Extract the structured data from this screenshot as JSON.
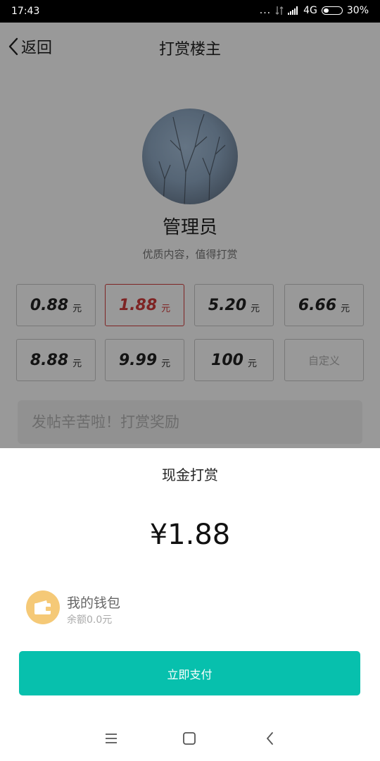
{
  "status_bar": {
    "time": "17:43",
    "dots": "...",
    "network": "4G",
    "battery": "30%",
    "icons": [
      "data-transfer-icon",
      "signal-icon",
      "battery-icon"
    ]
  },
  "navbar": {
    "back_label": "返回",
    "title": "打赏楼主"
  },
  "profile": {
    "name": "管理员",
    "subtitle": "优质内容，值得打赏"
  },
  "amounts": {
    "unit": "元",
    "options": [
      {
        "value": "0.88",
        "unit": "元"
      },
      {
        "value": "1.88",
        "unit": "元",
        "selected": true
      },
      {
        "value": "5.20",
        "unit": "元"
      },
      {
        "value": "6.66",
        "unit": "元"
      },
      {
        "value": "8.88",
        "unit": "元"
      },
      {
        "value": "9.99",
        "unit": "元"
      },
      {
        "value": "100",
        "unit": "元"
      }
    ],
    "custom_label": "自定义"
  },
  "message": {
    "placeholder": "发帖辛苦啦！打赏奖励"
  },
  "sheet": {
    "title": "现金打赏",
    "amount": "¥1.88",
    "wallet": {
      "name": "我的钱包",
      "balance": "余额0.0元",
      "icon": "wallet-icon"
    },
    "pay_button": "立即支付"
  },
  "colors": {
    "accent": "#07c0ad",
    "selected": "#d33c3c",
    "wallet_icon_bg": "#f5c977"
  },
  "system_nav": [
    "menu-icon",
    "home-icon",
    "back-icon"
  ]
}
